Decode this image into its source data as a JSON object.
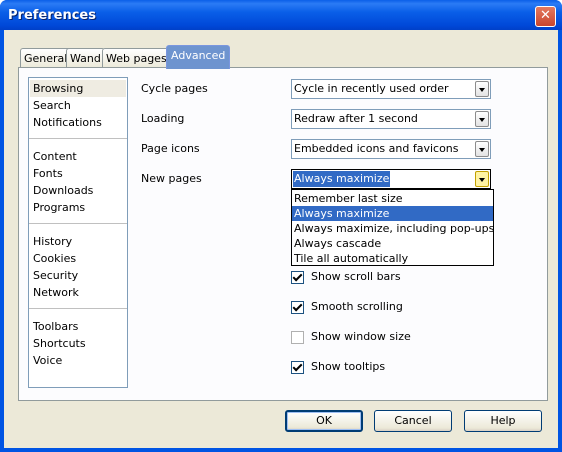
{
  "window": {
    "title": "Preferences"
  },
  "tabs": [
    "General",
    "Wand",
    "Web pages",
    "Advanced"
  ],
  "sidebar": {
    "groups": [
      [
        "Browsing",
        "Search",
        "Notifications"
      ],
      [
        "Content",
        "Fonts",
        "Downloads",
        "Programs"
      ],
      [
        "History",
        "Cookies",
        "Security",
        "Network"
      ],
      [
        "Toolbars",
        "Shortcuts",
        "Voice"
      ]
    ],
    "selected": "Browsing"
  },
  "settings": {
    "cycle_pages": {
      "label": "Cycle pages",
      "value": "Cycle in recently used order"
    },
    "loading": {
      "label": "Loading",
      "value": "Redraw after 1 second"
    },
    "page_icons": {
      "label": "Page icons",
      "value": "Embedded icons and favicons"
    },
    "new_pages": {
      "label": "New pages",
      "value": "Always maximize",
      "options": [
        "Remember last size",
        "Always maximize",
        "Always maximize, including pop-ups",
        "Always cascade",
        "Tile all automatically"
      ],
      "highlighted": "Always maximize"
    }
  },
  "checkboxes": [
    {
      "label": "Show scroll bars",
      "checked": true
    },
    {
      "label": "Smooth scrolling",
      "checked": true
    },
    {
      "label": "Show window size",
      "checked": false
    },
    {
      "label": "Show tooltips",
      "checked": true
    }
  ],
  "buttons": {
    "ok": "OK",
    "cancel": "Cancel",
    "help": "Help"
  }
}
